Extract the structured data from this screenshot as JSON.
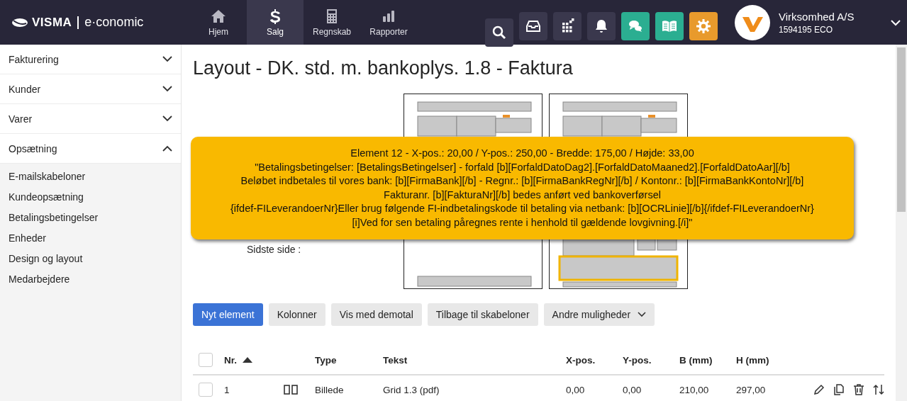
{
  "header": {
    "brand": "VISMA",
    "product": "e·conomic",
    "nav": [
      {
        "label": "Hjem",
        "selected": false
      },
      {
        "label": "Salg",
        "selected": true
      },
      {
        "label": "Regnskab",
        "selected": false
      },
      {
        "label": "Rapporter",
        "selected": false
      }
    ],
    "tools": [
      {
        "color": "#3a384d"
      },
      {
        "color": "#3a384d"
      },
      {
        "color": "#3a384d"
      },
      {
        "color": "#3a384d"
      },
      {
        "color": "#2bae91"
      },
      {
        "color": "#2bae91"
      },
      {
        "color": "#e89a2c"
      }
    ],
    "account": {
      "name": "Virksomhed A/S",
      "number": "1594195 ECO"
    }
  },
  "sidebar": {
    "sections": [
      {
        "label": "Fakturering",
        "expanded": false
      },
      {
        "label": "Kunder",
        "expanded": false
      },
      {
        "label": "Varer",
        "expanded": false
      },
      {
        "label": "Opsætning",
        "expanded": true,
        "children": [
          "E-mailskabeloner",
          "Kundeopsætning",
          "Betalingsbetingelser",
          "Enheder",
          "Design og layout",
          "Medarbejdere"
        ]
      }
    ]
  },
  "title": "Layout - DK. std. m. bankoplys. 1.8 - Faktura",
  "preview": {
    "label": "Sidste side :"
  },
  "tooltip": {
    "lines": [
      "Element 12 - X-pos.: 20,00 / Y-pos.: 250,00 - Bredde: 175,00 / Højde: 33,00",
      "\"Betalingsbetingelser: [BetalingsBetingelser] - forfald [b][ForfaldDatoDag2].[ForfaldDatoMaaned2].[ForfaldDatoAar][/b]",
      "Beløbet indbetales til vores bank: [b][FirmaBank][/b] - Regnr.: [b][FirmaBankRegNr][/b] / Kontonr.: [b][FirmaBankKontoNr][/b]",
      "Fakturanr. [b][FakturaNr][/b] bedes anført ved bankoverførsel",
      "{ifdef-FILeverandoerNr}Eller brug følgende FI-indbetalingskode til betaling via netbank: [b][OCRLinie][/b]{/ifdef-FILeverandoerNr}",
      "[i]Ved for sen betaling påregnes rente i henhold til gældende lovgivning.[/i]\""
    ]
  },
  "toolbar": [
    {
      "label": "Nyt element",
      "kind": "primary"
    },
    {
      "label": "Kolonner",
      "kind": "default"
    },
    {
      "label": "Vis med demotal",
      "kind": "default"
    },
    {
      "label": "Tilbage til skabeloner",
      "kind": "default"
    },
    {
      "label": "Andre muligheder",
      "kind": "dropdown"
    }
  ],
  "table": {
    "all_checked": false,
    "columns": [
      {
        "label": "Nr.",
        "sorted": true
      },
      {
        "label": "Type",
        "sorted": false
      },
      {
        "label": "Tekst",
        "sorted": false
      },
      {
        "label": "X-pos.",
        "sorted": false
      },
      {
        "label": "Y-pos.",
        "sorted": false
      },
      {
        "label": "B (mm)",
        "sorted": false
      },
      {
        "label": "H (mm)",
        "sorted": false
      }
    ],
    "rows": [
      {
        "checked": false,
        "cells": [
          "1",
          "Billede",
          "Grid 1.3 (pdf)",
          "0,00",
          "0,00",
          "210,00",
          "297,00"
        ]
      }
    ]
  }
}
